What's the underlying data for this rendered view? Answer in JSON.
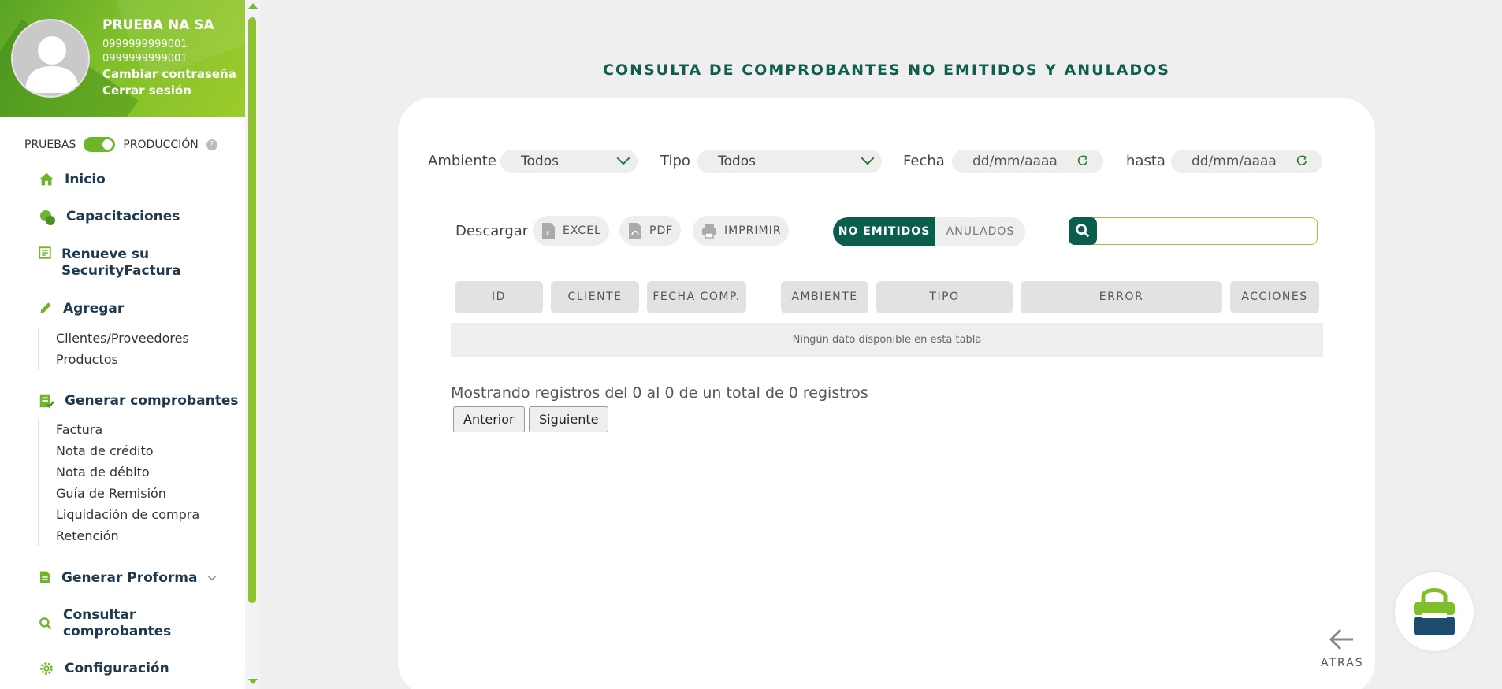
{
  "profile": {
    "name": "PRUEBA NA SA",
    "ruc1": "0999999999001",
    "ruc2": "0999999999001",
    "change_password": "Cambiar contraseña",
    "logout": "Cerrar sesión"
  },
  "environment": {
    "left_label": "PRUEBAS",
    "right_label": "PRODUCCIÓN",
    "help": "?",
    "toggle_on": true
  },
  "nav": {
    "inicio": "Inicio",
    "capacitaciones": "Capacitaciones",
    "renueve_1": "Renueve su",
    "renueve_2": "SecurityFactura",
    "agregar": "Agregar",
    "agregar_items": [
      "Clientes/Proveedores",
      "Productos"
    ],
    "generar": "Generar comprobantes",
    "generar_items": [
      "Factura",
      "Nota de crédito",
      "Nota de débito",
      "Guía de Remisión",
      "Liquidación de compra",
      "Retención"
    ],
    "proforma": "Generar Proforma",
    "consultar_1": "Consultar",
    "consultar_2": "comprobantes",
    "configuracion": "Configuración"
  },
  "page": {
    "title": "CONSULTA DE COMPROBANTES NO EMITIDOS Y ANULADOS"
  },
  "filters": {
    "ambiente_label": "Ambiente",
    "ambiente_value": "Todos",
    "tipo_label": "Tipo",
    "tipo_value": "Todos",
    "fecha_label": "Fecha",
    "fecha_placeholder": "dd/mm/aaaa",
    "hasta_label": "hasta",
    "hasta_placeholder": "dd/mm/aaaa"
  },
  "download": {
    "label": "Descargar",
    "excel": "EXCEL",
    "pdf": "PDF",
    "print": "IMPRIMIR"
  },
  "segment": {
    "active": "NO EMITIDOS",
    "inactive": "ANULADOS"
  },
  "search": {
    "value": ""
  },
  "table": {
    "headers": [
      "ID",
      "CLIENTE",
      "FECHA COMP.",
      "AMBIENTE",
      "TIPO",
      "ERROR",
      "ACCIONES"
    ],
    "empty": "Ningún dato disponible en esta tabla",
    "info": "Mostrando registros del 0 al 0 de un total de 0 registros",
    "prev": "Anterior",
    "next": "Siguiente"
  },
  "footer": {
    "back": "ATRAS"
  },
  "colors": {
    "brand_green": "#6fb52c",
    "dark_green": "#0c5e4c",
    "navy": "#1f3a4f"
  }
}
